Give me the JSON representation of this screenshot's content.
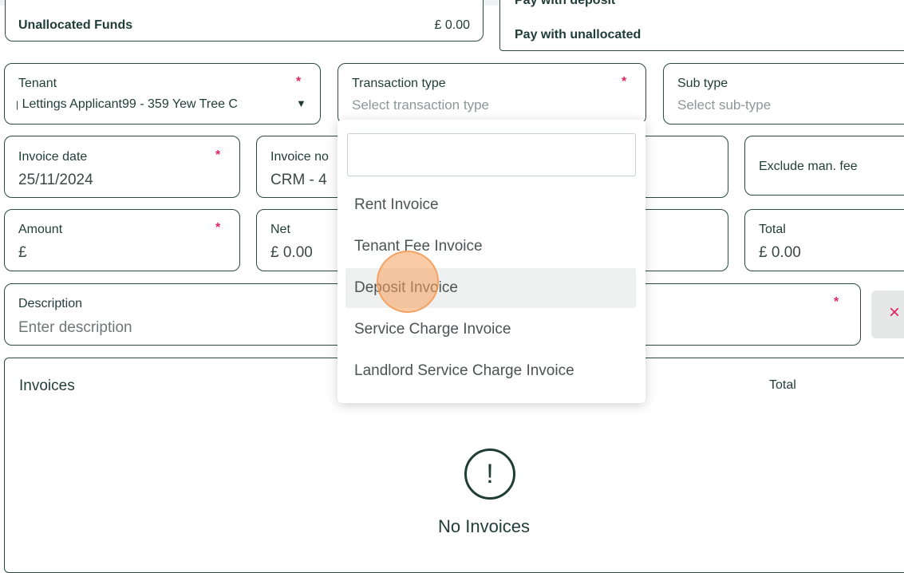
{
  "funds": {
    "label": "Unallocated Funds",
    "value": "£ 0.00"
  },
  "pay_options": {
    "deposit_label": "Pay with deposit",
    "unallocated_label": "Pay with unallocated"
  },
  "form": {
    "tenant": {
      "label": "Tenant",
      "value": "Lettings Applicant99 - 359 Yew Tree C",
      "required_mark": "*"
    },
    "transaction_type": {
      "label": "Transaction type",
      "placeholder": "Select transaction type",
      "required_mark": "*"
    },
    "sub_type": {
      "label": "Sub type",
      "placeholder": "Select sub-type"
    },
    "invoice_date": {
      "label": "Invoice date",
      "value": "25/11/2024",
      "required_mark": "*"
    },
    "invoice_no": {
      "label": "Invoice no",
      "value": "CRM - 4"
    },
    "exclude_fee": {
      "label": "Exclude man. fee"
    },
    "amount": {
      "label": "Amount",
      "value": "£",
      "required_mark": "*"
    },
    "net": {
      "label": "Net",
      "value": "£ 0.00"
    },
    "total": {
      "label": "Total",
      "value": "£ 0.00"
    },
    "description": {
      "label": "Description",
      "placeholder": "Enter description",
      "required_mark": "*"
    },
    "remove_button": "×"
  },
  "dropdown": {
    "search_value": "",
    "items": [
      "Rent Invoice",
      "Tenant Fee Invoice",
      "Deposit Invoice",
      "Service Charge Invoice",
      "Landlord Service Charge Invoice"
    ],
    "highlighted_index": 2
  },
  "invoices": {
    "title": "Invoices",
    "total_header": "Total",
    "empty_icon": "alert-circle-icon",
    "empty_glyph": "!",
    "empty_text": "No Invoices"
  }
}
